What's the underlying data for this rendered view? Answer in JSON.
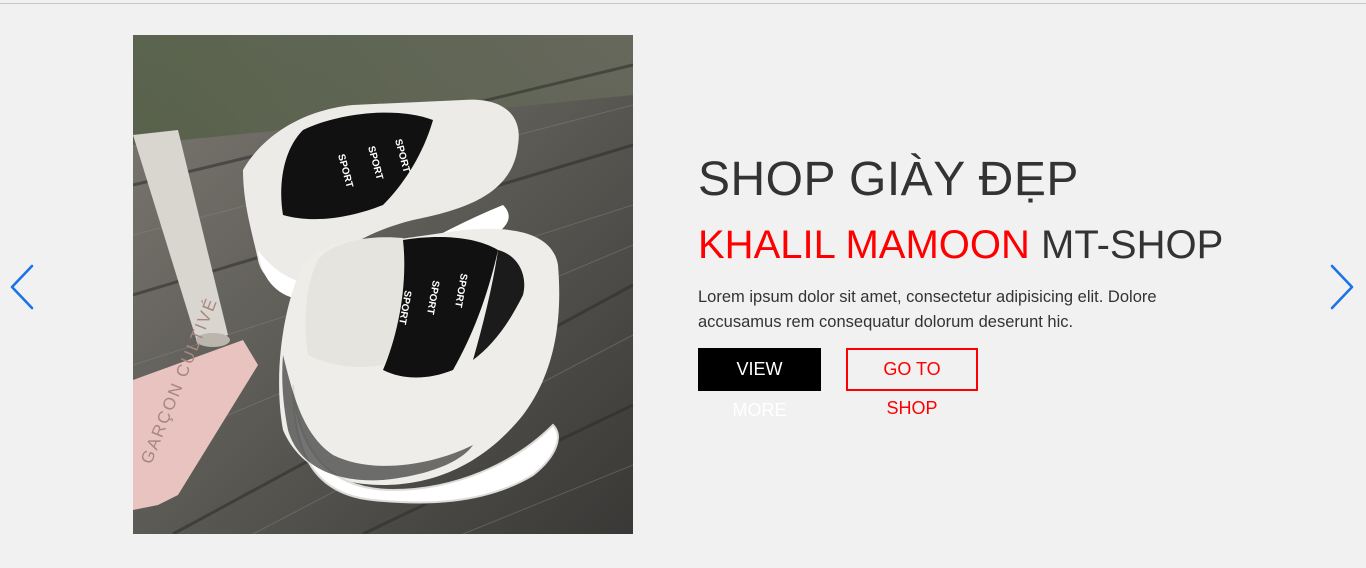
{
  "slider": {
    "prev_icon": "chevron-left-icon",
    "next_icon": "chevron-right-icon",
    "arrow_color": "#1a73e8",
    "image": {
      "subject": "white and black sport sneakers on wooden deck",
      "shoe_print": "SPORT",
      "case_print": "GARÇON CULTIVÉ"
    },
    "caption": {
      "title": "SHOP GIÀY ĐẸP",
      "brand_highlight": "KHALIL MAMOON",
      "brand_suffix": "MT-SHOP",
      "description": "Lorem ipsum dolor sit amet, consectetur adipisicing elit. Dolore accusamus rem consequatur dolorum deserunt hic.",
      "primary_button": "VIEW MORE",
      "secondary_button": "GO TO SHOP"
    },
    "colors": {
      "background": "#f1f1f1",
      "accent": "#ff0000",
      "text": "#333333"
    }
  }
}
